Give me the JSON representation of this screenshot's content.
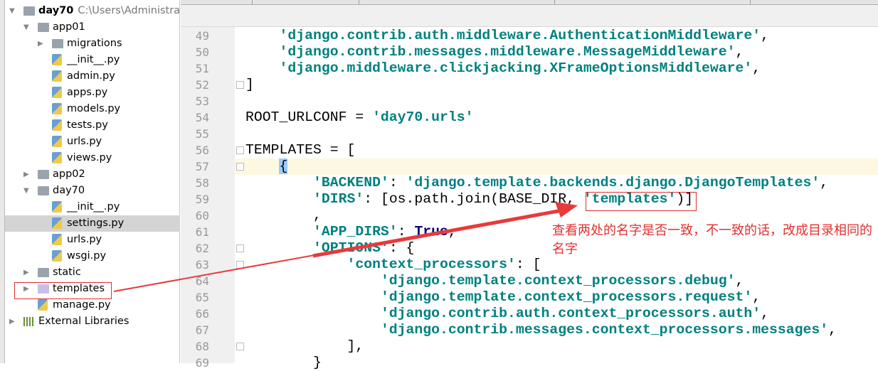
{
  "tree": [
    {
      "label": "day70",
      "extra": "C:\\Users\\Administrator\\",
      "depth": 0,
      "type": "folder",
      "arrow": "open",
      "bold": true
    },
    {
      "label": "app01",
      "depth": 1,
      "type": "folder",
      "arrow": "open"
    },
    {
      "label": "migrations",
      "depth": 2,
      "type": "folder",
      "arrow": "closed"
    },
    {
      "label": "__init__.py",
      "depth": 2,
      "type": "py"
    },
    {
      "label": "admin.py",
      "depth": 2,
      "type": "py"
    },
    {
      "label": "apps.py",
      "depth": 2,
      "type": "py"
    },
    {
      "label": "models.py",
      "depth": 2,
      "type": "py"
    },
    {
      "label": "tests.py",
      "depth": 2,
      "type": "py"
    },
    {
      "label": "urls.py",
      "depth": 2,
      "type": "py"
    },
    {
      "label": "views.py",
      "depth": 2,
      "type": "py"
    },
    {
      "label": "app02",
      "depth": 1,
      "type": "folder",
      "arrow": "closed"
    },
    {
      "label": "day70",
      "depth": 1,
      "type": "folder",
      "arrow": "open"
    },
    {
      "label": "__init__.py",
      "depth": 2,
      "type": "py"
    },
    {
      "label": "settings.py",
      "depth": 2,
      "type": "py",
      "selected": true
    },
    {
      "label": "urls.py",
      "depth": 2,
      "type": "py"
    },
    {
      "label": "wsgi.py",
      "depth": 2,
      "type": "py"
    },
    {
      "label": "static",
      "depth": 1,
      "type": "folder",
      "arrow": "closed"
    },
    {
      "label": "templates",
      "depth": 1,
      "type": "folder-purple",
      "arrow": "closed"
    },
    {
      "label": "manage.py",
      "depth": 1,
      "type": "py"
    },
    {
      "label": "External Libraries",
      "depth": 0,
      "type": "lib",
      "arrow": "closed"
    }
  ],
  "code": [
    {
      "num": "49",
      "parts": [
        {
          "t": "    "
        },
        {
          "t": "'django.contrib.auth.middleware.AuthenticationMiddleware'",
          "s": "s"
        },
        {
          "t": ","
        }
      ]
    },
    {
      "num": "50",
      "parts": [
        {
          "t": "    "
        },
        {
          "t": "'django.contrib.messages.middleware.MessageMiddleware'",
          "s": "s"
        },
        {
          "t": ","
        }
      ]
    },
    {
      "num": "51",
      "parts": [
        {
          "t": "    "
        },
        {
          "t": "'django.middleware.clickjacking.XFrameOptionsMiddleware'",
          "s": "s"
        },
        {
          "t": ","
        }
      ]
    },
    {
      "num": "52",
      "fold": true,
      "parts": [
        {
          "t": "]"
        }
      ]
    },
    {
      "num": "53",
      "parts": []
    },
    {
      "num": "54",
      "parts": [
        {
          "t": "ROOT_URLCONF = "
        },
        {
          "t": "'day70.urls'",
          "s": "s"
        }
      ]
    },
    {
      "num": "55",
      "parts": []
    },
    {
      "num": "56",
      "fold": true,
      "parts": [
        {
          "t": "TEMPLATES = ["
        }
      ]
    },
    {
      "num": "57",
      "fold": true,
      "current": true,
      "parts": [
        {
          "t": "    "
        },
        {
          "t": "{",
          "s": "hl"
        }
      ]
    },
    {
      "num": "58",
      "parts": [
        {
          "t": "        "
        },
        {
          "t": "'BACKEND'",
          "s": "s"
        },
        {
          "t": ": "
        },
        {
          "t": "'django.template.backends.django.DjangoTemplates'",
          "s": "s"
        },
        {
          "t": ","
        }
      ]
    },
    {
      "num": "59",
      "parts": [
        {
          "t": "        "
        },
        {
          "t": "'DIRS'",
          "s": "s"
        },
        {
          "t": ": [os.path.join(BASE_DIR, "
        },
        {
          "t": "'templates'",
          "s": "s"
        },
        {
          "t": ")]"
        }
      ]
    },
    {
      "num": "60",
      "parts": [
        {
          "t": "        ,"
        }
      ]
    },
    {
      "num": "61",
      "parts": [
        {
          "t": "        "
        },
        {
          "t": "'APP_DIRS'",
          "s": "s"
        },
        {
          "t": ": "
        },
        {
          "t": "True",
          "s": "k"
        },
        {
          "t": ","
        }
      ]
    },
    {
      "num": "62",
      "fold": true,
      "parts": [
        {
          "t": "        "
        },
        {
          "t": "'OPTIONS'",
          "s": "s"
        },
        {
          "t": ": {"
        }
      ]
    },
    {
      "num": "63",
      "fold": true,
      "parts": [
        {
          "t": "            "
        },
        {
          "t": "'context_processors'",
          "s": "s"
        },
        {
          "t": ": ["
        }
      ]
    },
    {
      "num": "64",
      "parts": [
        {
          "t": "                "
        },
        {
          "t": "'django.template.context_processors.debug'",
          "s": "s"
        },
        {
          "t": ","
        }
      ]
    },
    {
      "num": "65",
      "parts": [
        {
          "t": "                "
        },
        {
          "t": "'django.template.context_processors.request'",
          "s": "s"
        },
        {
          "t": ","
        }
      ]
    },
    {
      "num": "66",
      "parts": [
        {
          "t": "                "
        },
        {
          "t": "'django.contrib.auth.context_processors.auth'",
          "s": "s"
        },
        {
          "t": ","
        }
      ]
    },
    {
      "num": "67",
      "parts": [
        {
          "t": "                "
        },
        {
          "t": "'django.contrib.messages.context_processors.messages'",
          "s": "s"
        },
        {
          "t": ","
        }
      ]
    },
    {
      "num": "68",
      "fold": true,
      "parts": [
        {
          "t": "            ],"
        }
      ]
    },
    {
      "num": "69",
      "parts": [
        {
          "t": "        }"
        }
      ]
    }
  ],
  "annotation": {
    "text": "查看两处的名字是否一致，不一致的话，改成目录相同的名字",
    "color": "#e03030"
  },
  "colors": {
    "string": "#008080",
    "keyword": "#000080",
    "annotation": "#e03030",
    "selection": "#d4d4d4"
  }
}
